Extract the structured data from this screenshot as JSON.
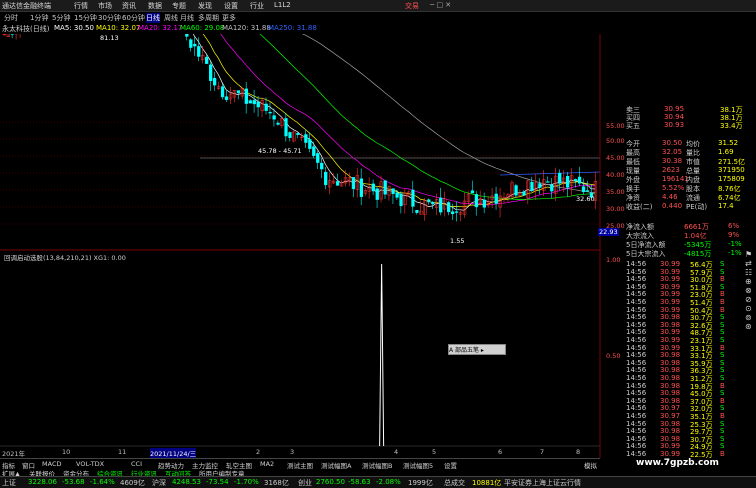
{
  "menu": {
    "title": "通达信金融终端",
    "items": [
      "行情",
      "市场",
      "资讯",
      "数据",
      "专题",
      "发现",
      "设置",
      "行业",
      "L1L2"
    ],
    "trade": "交易"
  },
  "timeframes": [
    "分时",
    "1分钟",
    "5分钟",
    "15分钟",
    "30分钟",
    "60分钟",
    "日线",
    "周线",
    "月线",
    "多周期",
    "更多"
  ],
  "active_timeframe": 6,
  "ma_legend": {
    "stock": "永太科技(日线)",
    "ma5": "MA5: 30.50",
    "ma10": "MA10: 32.07",
    "ma20": "MA20: 32.17",
    "ma60": "MA60: 29.08",
    "ma120": "MA120: 31.88",
    "ma250": "MA250: 31.88"
  },
  "colors": {
    "up": "#ff3232",
    "down": "#00ffff",
    "ma5": "#ffffff",
    "ma10": "#ffff00",
    "ma20": "#ff00ff",
    "ma60": "#00ff00",
    "ma120": "#a0a0a0",
    "ma250": "#3060ff",
    "grid": "#7a0000",
    "indicator": "#ffffff"
  },
  "price_annotations": {
    "high": "81.13",
    "level": "45.78 - 45.71",
    "right_mark": "32.60",
    "low_mark": "1.55",
    "current_box": "22.93"
  },
  "price_axis": [
    "55.00",
    "50.00",
    "45.00",
    "40.00",
    "35.00",
    "30.00",
    "25.00"
  ],
  "indicator_title": "回调启动选股(13,84,210,21) XG1: 0.00",
  "indicator_axis": [
    "1.00",
    "0.50"
  ],
  "popup_label": "A 部品五笔 ▸",
  "date_axis": {
    "start": "2021年",
    "labels": [
      "10",
      "11",
      "2021/11/24/三",
      "2",
      "3",
      "4",
      "5",
      "6",
      "7",
      "8"
    ]
  },
  "chart_data": {
    "type": "candlestick",
    "title": "永太科技(日线)",
    "x": [
      "2021-09",
      "2021-10",
      "2021-11",
      "2021-12",
      "2022-01",
      "2022-02",
      "2022-03",
      "2022-04",
      "2022-05",
      "2022-06",
      "2022-07",
      "2022-08"
    ],
    "close": [
      60.0,
      70.0,
      74.0,
      66.0,
      50.0,
      45.0,
      33.0,
      30.0,
      27.0,
      29.0,
      32.5,
      30.5
    ],
    "high_value": 81.13,
    "ylim": [
      22,
      60
    ],
    "indicator": {
      "name": "XG1",
      "signal_at": "2022-04",
      "value": 1.0
    },
    "ma_values": {
      "MA5": 30.5,
      "MA10": 32.07,
      "MA20": 32.17,
      "MA60": 29.08,
      "MA120": 31.88
    }
  },
  "quote": {
    "order_rows": [
      {
        "label": "卖三",
        "price": "30.95",
        "vol": "38.1万"
      },
      {
        "label": "买四",
        "price": "30.94",
        "vol": "38.1万"
      },
      {
        "label": "买五",
        "price": "30.93",
        "vol": "33.4万"
      }
    ],
    "stats": [
      {
        "l1": "今开",
        "v1": "30.50",
        "l2": "均价",
        "v2": "31.52"
      },
      {
        "l1": "最高",
        "v1": "32.05",
        "l2": "量比",
        "v2": "1.69"
      },
      {
        "l1": "最低",
        "v1": "30.38",
        "l2": "市值",
        "v2": "271.5亿"
      },
      {
        "l1": "现量",
        "v1": "2623",
        "l2": "总量",
        "v2": "371950"
      },
      {
        "l1": "外盘",
        "v1": "196141",
        "l2": "内盘",
        "v2": "175809"
      },
      {
        "l1": "换手",
        "v1": "5.52%",
        "l2": "股本",
        "v2": "8.76亿"
      },
      {
        "l1": "净资",
        "v1": "4.46",
        "l2": "流通",
        "v2": "6.74亿"
      },
      {
        "l1": "收益(二)",
        "v1": "0.440",
        "l2": "PE(动)",
        "v2": "17.4"
      }
    ],
    "flows": [
      {
        "label": "净流入额",
        "value": "6661万",
        "pct": "6%"
      },
      {
        "label": "大宗流入",
        "value": "1.04亿",
        "pct": "9%"
      },
      {
        "label": "5日净流入额",
        "value": "-5345万",
        "pct": "-1%"
      },
      {
        "label": "5日大宗流入",
        "value": "-4815万",
        "pct": "-1%"
      }
    ],
    "ticks": [
      {
        "t": "14:56",
        "p": "30.99",
        "v": "56.4万",
        "s": "S"
      },
      {
        "t": "14:56",
        "p": "30.99",
        "v": "57.9万",
        "s": "S"
      },
      {
        "t": "14:56",
        "p": "30.99",
        "v": "30.0万",
        "s": "B"
      },
      {
        "t": "14:56",
        "p": "30.99",
        "v": "51.8万",
        "s": "S"
      },
      {
        "t": "14:56",
        "p": "30.99",
        "v": "23.0万",
        "s": "B"
      },
      {
        "t": "14:56",
        "p": "30.99",
        "v": "51.4万",
        "s": "B"
      },
      {
        "t": "14:56",
        "p": "30.99",
        "v": "50.4万",
        "s": "B"
      },
      {
        "t": "14:56",
        "p": "30.98",
        "v": "30.7万",
        "s": "S"
      },
      {
        "t": "14:56",
        "p": "30.98",
        "v": "32.6万",
        "s": "S"
      },
      {
        "t": "14:56",
        "p": "30.99",
        "v": "48.7万",
        "s": "S"
      },
      {
        "t": "14:56",
        "p": "30.99",
        "v": "23.1万",
        "s": "S"
      },
      {
        "t": "14:56",
        "p": "30.99",
        "v": "33.1万",
        "s": "B"
      },
      {
        "t": "14:56",
        "p": "30.98",
        "v": "33.1万",
        "s": "S"
      },
      {
        "t": "14:56",
        "p": "30.98",
        "v": "35.9万",
        "s": "S"
      },
      {
        "t": "14:56",
        "p": "30.98",
        "v": "36.3万",
        "s": "S"
      },
      {
        "t": "14:56",
        "p": "30.98",
        "v": "31.2万",
        "s": "S"
      },
      {
        "t": "14:56",
        "p": "30.98",
        "v": "19.8万",
        "s": "B"
      },
      {
        "t": "14:56",
        "p": "30.98",
        "v": "45.0万",
        "s": "S"
      },
      {
        "t": "14:56",
        "p": "30.98",
        "v": "37.0万",
        "s": "B"
      },
      {
        "t": "14:56",
        "p": "30.97",
        "v": "32.0万",
        "s": "S"
      },
      {
        "t": "14:56",
        "p": "30.97",
        "v": "35.1万",
        "s": "B"
      },
      {
        "t": "14:56",
        "p": "30.98",
        "v": "25.3万",
        "s": "S"
      },
      {
        "t": "14:56",
        "p": "30.98",
        "v": "29.7万",
        "s": "S"
      },
      {
        "t": "14:56",
        "p": "30.98",
        "v": "30.7万",
        "s": "S"
      },
      {
        "t": "14:56",
        "p": "30.99",
        "v": "24.9万",
        "s": "S"
      },
      {
        "t": "14:56",
        "p": "30.99",
        "v": "22.5万",
        "s": "B"
      }
    ]
  },
  "bottom_tabs_row1": [
    "指标",
    "窗口",
    "MACD",
    "VOL-TDX",
    "CCI",
    "趋势动力",
    "主力监控",
    "轧空主图",
    "MA2",
    "测试主图",
    "测试幅图A",
    "测试幅图B",
    "测试幅图5",
    "设置"
  ],
  "bottom_tabs_row2": [
    "扩展▲",
    "关联报价",
    "资金分布",
    "综合资讯",
    "行业资讯",
    "互动问答",
    "所用户编制专章"
  ],
  "bottom_right": "模拟",
  "status": {
    "sh_label": "上证",
    "sh_val": "3228.06",
    "sh_chg": "-53.68",
    "sh_pct": "-1.64%",
    "sh_amt": "4609亿",
    "sz_label": "沪深",
    "sz_val": "4248.53",
    "sz_chg": "-73.54",
    "sz_pct": "-1.70%",
    "sz_amt": "3168亿",
    "cy_label": "创业",
    "cy_val": "2760.50",
    "cy_chg": "-58.63",
    "cy_pct": "-2.08%",
    "cy_amt": "1999亿",
    "deal_label": "总成交",
    "deal_val": "10881亿",
    "broker": "平安证券上海上证云行情"
  },
  "watermark": "www.7gpzb.com",
  "side_icons": [
    "⚑",
    "⇄",
    "☷",
    "⊕",
    "⊗",
    "⊘",
    "⊙",
    "⊚",
    "⊛"
  ]
}
